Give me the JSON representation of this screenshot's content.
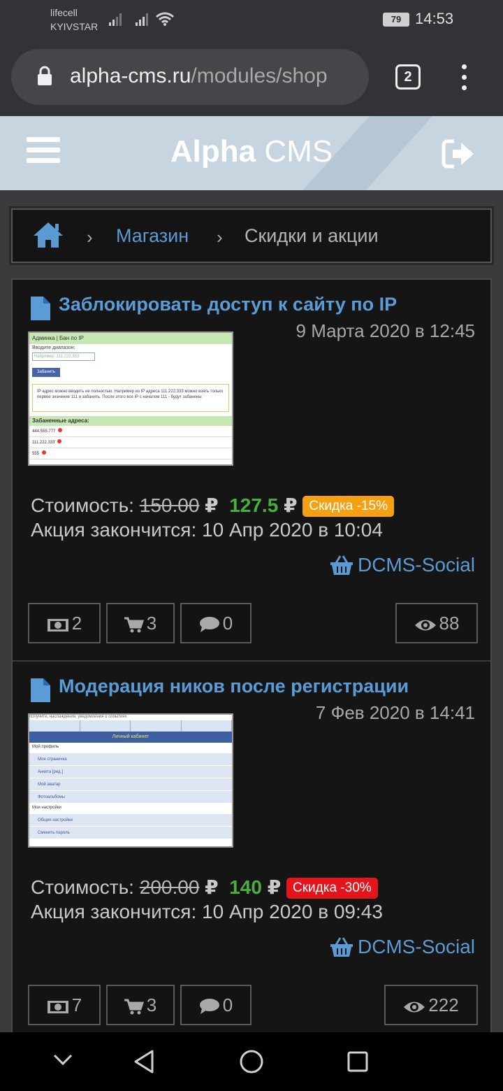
{
  "status": {
    "carrier_line1": "lifecell",
    "carrier_line2": "KYIVSTAR",
    "battery": "79",
    "time": "14:53"
  },
  "browser": {
    "url_host": "alpha-cms.ru",
    "url_path": "/modules/shop",
    "tab_count": "2"
  },
  "header": {
    "title_bold": "Alpha",
    "title_rest": " CMS"
  },
  "breadcrumb": {
    "link": "Магазин",
    "current": "Скидки и акции"
  },
  "products": [
    {
      "title": "Заблокировать доступ к сайту по IP",
      "date": "9 Марта 2020 в 12:45",
      "price_label": "Стоимость:",
      "price_old": "150.00",
      "price_new": "127.5",
      "currency": "₽",
      "discount": "Скидка -15%",
      "promo": "Акция закончится: 10 Апр 2020 в 10:04",
      "vendor": "DCMS-Social",
      "stats": {
        "money": "2",
        "cart": "3",
        "comments": "0",
        "views": "88"
      },
      "thumb": {
        "bar": "Админка | Бан по IP",
        "label": "Вводите диапазон:",
        "placeholder": "Например: 111.222.333",
        "button": "Забанить",
        "note": "IP адрес можно вводить не полностью. Например из IP адреса 111.222.333 можно взять только первое значение 111 и забанить. После этого все IP с началом 111 - будут забанены",
        "header": "Забаненные адреса:",
        "rows": [
          "444.555.777",
          "111.222.333",
          "555"
        ]
      }
    },
    {
      "title": "Модерация ников после регистрации",
      "date": "7 Фев 2020 в 14:41",
      "price_label": "Стоимость:",
      "price_old": "200.00",
      "price_new": "140",
      "currency": "₽",
      "discount": "Скидка -30%",
      "promo": "Акция закончится: 10 Апр 2020 в 09:43",
      "vendor": "DCMS-Social",
      "stats": {
        "money": "7",
        "cart": "3",
        "comments": "0",
        "views": "222"
      },
      "thumb": {
        "top": "получите, наслаждения, уведомления о событиях",
        "bar": "Личный кабинет",
        "sec1": "Мой профиль",
        "items1": [
          "Моя страничка",
          "Анкета [ред.]",
          "Мой аватар",
          "Фотоальбомы"
        ],
        "sec2": "Мои настройки",
        "items2": [
          "Общие настройки",
          "Сменить пароль"
        ]
      }
    }
  ],
  "colors": {
    "link": "#5c9ad2",
    "price_new": "#4aae3f",
    "badge_orange": "#f5a012",
    "badge_red": "#e6141b"
  }
}
